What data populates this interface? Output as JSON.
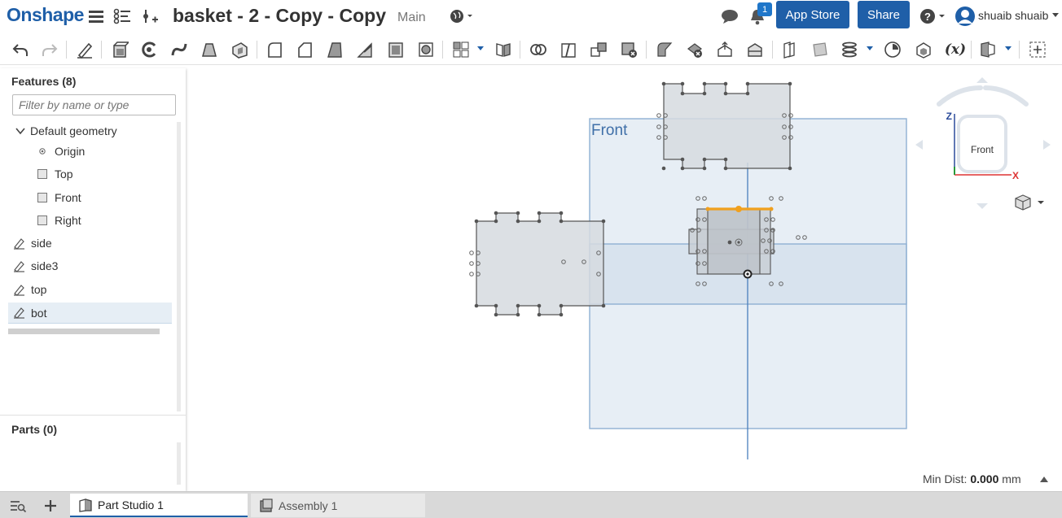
{
  "header": {
    "logo": "Onshape",
    "doc_title": "basket - 2 - Copy - Copy",
    "branch": "Main",
    "notification_count": "1",
    "app_store_label": "App Store",
    "share_label": "Share",
    "user_name": "shuaib shuaib",
    "icons": [
      "menu-icon",
      "feature-list-icon",
      "insert-icon",
      "globe-icon",
      "chat-icon",
      "bell-icon",
      "help-icon",
      "user-icon"
    ]
  },
  "toolbar": {
    "tools": [
      "undo",
      "redo",
      "sketch",
      "extrude",
      "revolve",
      "sweep",
      "loft",
      "thicken",
      "fillet",
      "chamfer",
      "draft",
      "rib",
      "shell",
      "hole",
      "pattern",
      "mirror",
      "boolean",
      "split",
      "transform",
      "delete-part",
      "modify-fillet",
      "delete-face",
      "move-face",
      "replace-face",
      "offset-surface",
      "plane",
      "helix",
      "mate-connector",
      "variable",
      "configurations",
      "expand"
    ],
    "variable_label": "(x)"
  },
  "features_panel": {
    "title": "Features (8)",
    "filter_placeholder": "Filter by name or type",
    "default_geometry_label": "Default geometry",
    "items": [
      {
        "label": "Origin",
        "icon": "origin-icon"
      },
      {
        "label": "Top",
        "icon": "plane-icon"
      },
      {
        "label": "Front",
        "icon": "plane-icon"
      },
      {
        "label": "Right",
        "icon": "plane-icon"
      },
      {
        "label": "side",
        "icon": "sketch-icon"
      },
      {
        "label": "side3",
        "icon": "sketch-icon"
      },
      {
        "label": "top",
        "icon": "sketch-icon"
      },
      {
        "label": "bot",
        "icon": "sketch-icon",
        "selected": true
      }
    ],
    "parts_title": "Parts (0)"
  },
  "viewport": {
    "plane_label": "Front",
    "view_cube_label": "Front",
    "axis_z": "Z",
    "axis_x": "X",
    "min_dist_label": "Min Dist:",
    "min_dist_value": "0.000",
    "min_dist_unit": "mm",
    "colors": {
      "plane_fill": "#dfe8f1",
      "plane_stroke": "#8fb0d3",
      "sketch_fill": "#d9dde2",
      "highlight": "#f0a01e"
    }
  },
  "tabs": {
    "items": [
      {
        "label": "Part Studio 1",
        "active": true
      },
      {
        "label": "Assembly 1",
        "active": false
      }
    ]
  }
}
